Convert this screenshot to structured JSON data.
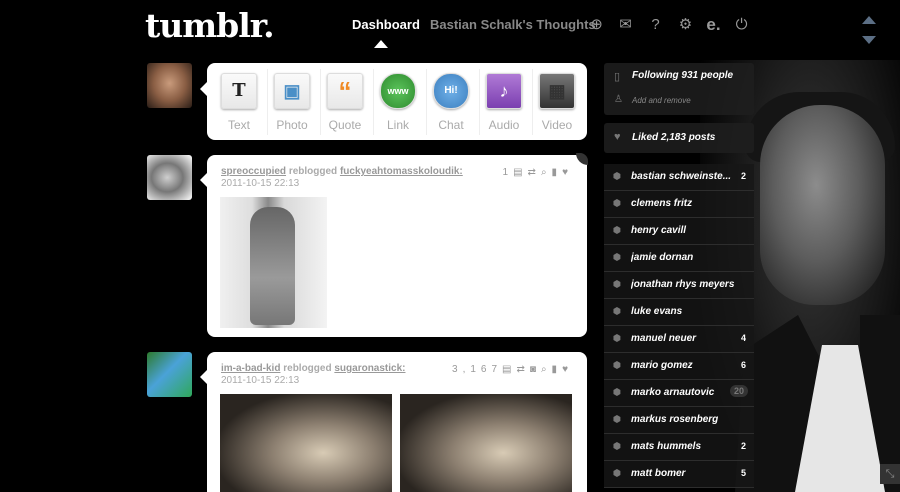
{
  "header": {
    "logo": "tumblr.",
    "nav_dashboard": "Dashboard",
    "nav_blog": "Bastian Schalk's Thoughts"
  },
  "post_types": [
    {
      "label": "Text",
      "icon": "T"
    },
    {
      "label": "Photo",
      "icon": "▣"
    },
    {
      "label": "Quote",
      "icon": "“"
    },
    {
      "label": "Link",
      "icon": "www"
    },
    {
      "label": "Chat",
      "icon": "Hi!"
    },
    {
      "label": "Audio",
      "icon": "♪"
    },
    {
      "label": "Video",
      "icon": "▦"
    }
  ],
  "posts": [
    {
      "user": "spreoccupied",
      "action": "reblogged",
      "source": "fuckyeahtomasskoloudik:",
      "date": "2011-10-15 22:13",
      "notes": "1"
    },
    {
      "user": "im-a-bad-kid",
      "action": "reblogged",
      "source": "sugaronastick:",
      "date": "2011-10-15 22:13",
      "notes": "3,167"
    }
  ],
  "sidebar": {
    "following": "Following 931 people",
    "following_sub": "Add and remove",
    "liked": "Liked 2,183 posts",
    "tags": [
      {
        "name": "bastian schweinste...",
        "count": "2"
      },
      {
        "name": "clemens fritz",
        "count": ""
      },
      {
        "name": "henry cavill",
        "count": ""
      },
      {
        "name": "jamie dornan",
        "count": ""
      },
      {
        "name": "jonathan rhys meyers",
        "count": ""
      },
      {
        "name": "luke evans",
        "count": ""
      },
      {
        "name": "manuel neuer",
        "count": "4"
      },
      {
        "name": "mario gomez",
        "count": "6"
      },
      {
        "name": "marko arnautovic",
        "count": "20"
      },
      {
        "name": "markus rosenberg",
        "count": ""
      },
      {
        "name": "mats hummels",
        "count": "2"
      },
      {
        "name": "matt bomer",
        "count": "5"
      }
    ]
  }
}
